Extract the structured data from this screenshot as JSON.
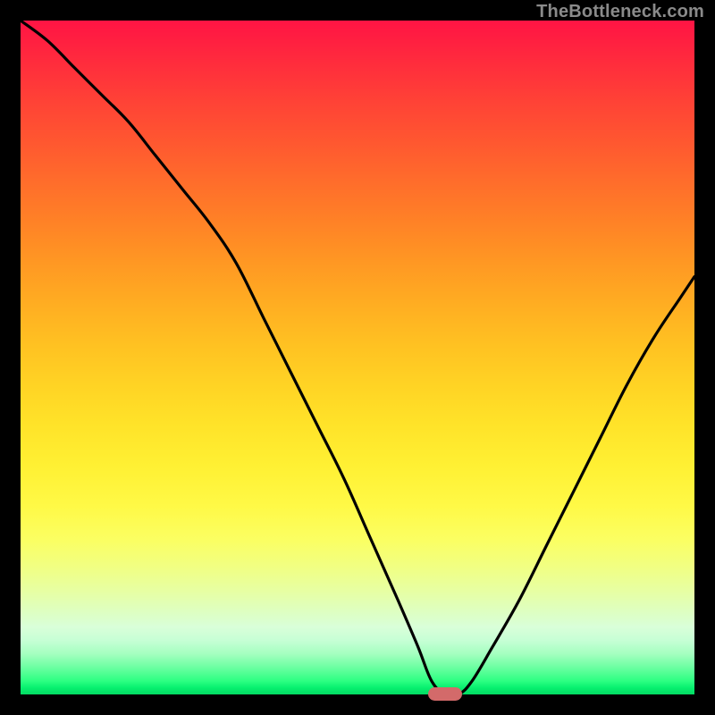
{
  "watermark": "TheBottleneck.com",
  "colors": {
    "page_bg": "#000000",
    "watermark": "#8a8a8a",
    "curve_stroke": "#000000",
    "marker": "#d36a6a",
    "gradient_top": "#ff1444",
    "gradient_bottom": "#03db63"
  },
  "chart_data": {
    "type": "line",
    "title": "",
    "xlabel": "",
    "ylabel": "",
    "xlim": [
      0,
      100
    ],
    "ylim": [
      0,
      100
    ],
    "annotation_marker": {
      "x": 63,
      "y": 0,
      "color": "#d36a6a"
    },
    "series": [
      {
        "name": "bottleneck-curve",
        "x": [
          0,
          4,
          8,
          12,
          16,
          20,
          24,
          28,
          32,
          36,
          40,
          44,
          48,
          52,
          56,
          59,
          61,
          63,
          65,
          67,
          70,
          74,
          78,
          82,
          86,
          90,
          94,
          98,
          100
        ],
        "values": [
          100,
          97,
          93,
          89,
          85,
          80,
          75,
          70,
          64,
          56,
          48,
          40,
          32,
          23,
          14,
          7,
          2,
          0,
          0,
          2,
          7,
          14,
          22,
          30,
          38,
          46,
          53,
          59,
          62
        ]
      }
    ]
  }
}
